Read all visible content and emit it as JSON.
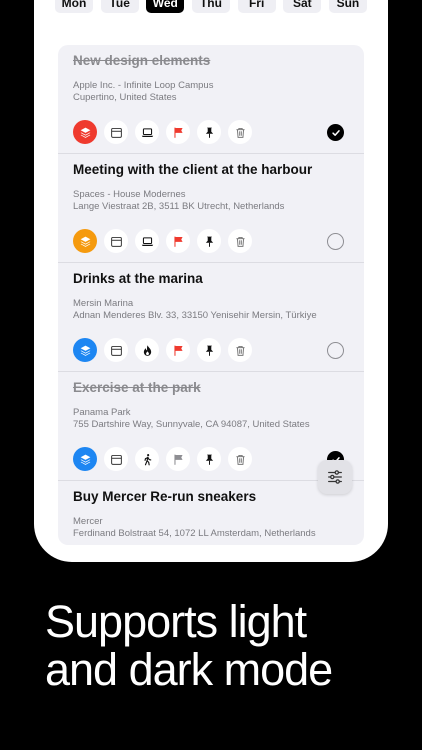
{
  "days": [
    {
      "label": "Mon",
      "selected": false
    },
    {
      "label": "Tue",
      "selected": false
    },
    {
      "label": "Wed",
      "selected": true
    },
    {
      "label": "Thu",
      "selected": false
    },
    {
      "label": "Fri",
      "selected": false
    },
    {
      "label": "Sat",
      "selected": false
    },
    {
      "label": "Sun",
      "selected": false
    }
  ],
  "tasks": [
    {
      "title": "New design elements",
      "location_line1": "Apple Inc. - Infinite Loop Campus",
      "location_line2": "Cupertino, United States",
      "done": true,
      "category_color": "#ef3a2e",
      "context_icon": "laptop-icon",
      "flag_color": "#ef3a2e"
    },
    {
      "title": "Meeting with the client at the harbour",
      "location_line1": "Spaces - House Modernes",
      "location_line2": "Lange Viestraat 2B, 3511 BK Utrecht, Netherlands",
      "done": false,
      "category_color": "#f59a0e",
      "context_icon": "laptop-icon",
      "flag_color": "#ef3a2e"
    },
    {
      "title": "Drinks at the marina",
      "location_line1": "Mersin Marina",
      "location_line2": "Adnan Menderes Blv. 33, 33150 Yenisehir Mersin, Türkiye",
      "done": false,
      "category_color": "#1d86f2",
      "context_icon": "flame-icon",
      "flag_color": "#ef3a2e"
    },
    {
      "title": "Exercise at the park",
      "location_line1": "Panama Park",
      "location_line2": "755 Dartshire Way, Sunnyvale, CA  94087, United States",
      "done": true,
      "category_color": "#1d86f2",
      "context_icon": "walking-icon",
      "flag_color": "#8e8e93"
    },
    {
      "title": "Buy Mercer Re-run sneakers",
      "location_line1": "Mercer",
      "location_line2": "Ferdinand Bolstraat 54, 1072 LL Amsterdam, Netherlands",
      "done": false,
      "category_color": "#1d86f2",
      "context_icon": "laptop-icon",
      "flag_color": "#ef3a2e"
    }
  ],
  "tagline": {
    "line1": "Supports light",
    "line2": "and dark mode"
  }
}
